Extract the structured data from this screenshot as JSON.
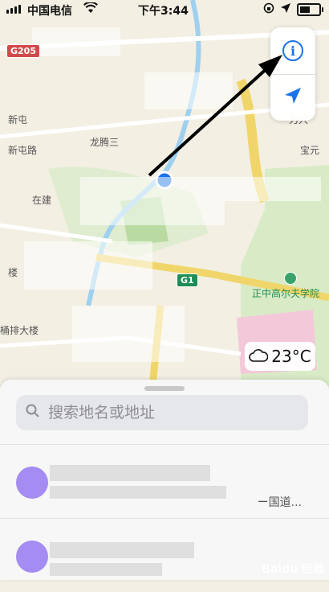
{
  "status_bar": {
    "carrier": "中国电信",
    "time": "下午3:44"
  },
  "map": {
    "road_shields": [
      "G205",
      "G1"
    ],
    "labels": [
      "新屯路",
      "新屯",
      "龙腾三",
      "在建",
      "楼",
      "桶排大楼",
      "力兴",
      "宝元"
    ],
    "poi": "正中高尔夫学院"
  },
  "controls": {
    "info_icon": "info-icon",
    "location_icon": "location-arrow-icon"
  },
  "weather": {
    "icon": "cloud-icon",
    "temperature": "23°C"
  },
  "sheet": {
    "search_placeholder": "搜索地名或地址",
    "rows": [
      {
        "subtitle": "ー国道..."
      },
      {
        "subtitle": ""
      }
    ]
  },
  "watermark": "Baidu 经验"
}
